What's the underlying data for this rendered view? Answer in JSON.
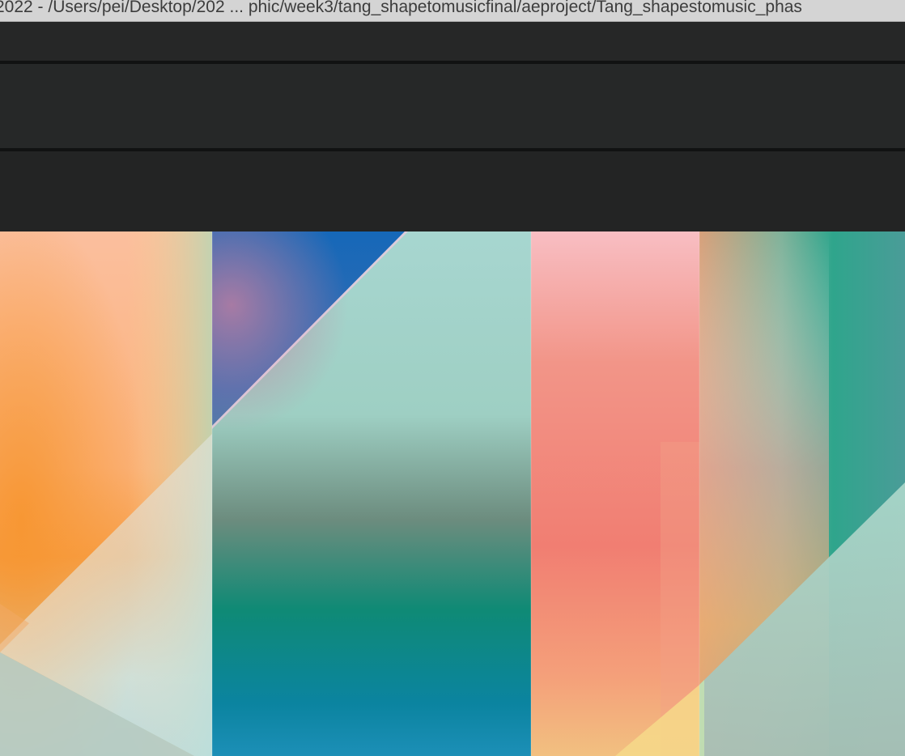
{
  "window": {
    "title": "2022 - /Users/pei/Desktop/202 ... phic/week3/tang_shapetomusicfinal/aeproject/Tang_shapestomusic_phas"
  },
  "colors": {
    "titlebar_bg": "#d4d4d4",
    "panel_bg": "#262727",
    "separator": "#111212"
  },
  "viewer": {
    "content": "abstract gradient artwork"
  }
}
